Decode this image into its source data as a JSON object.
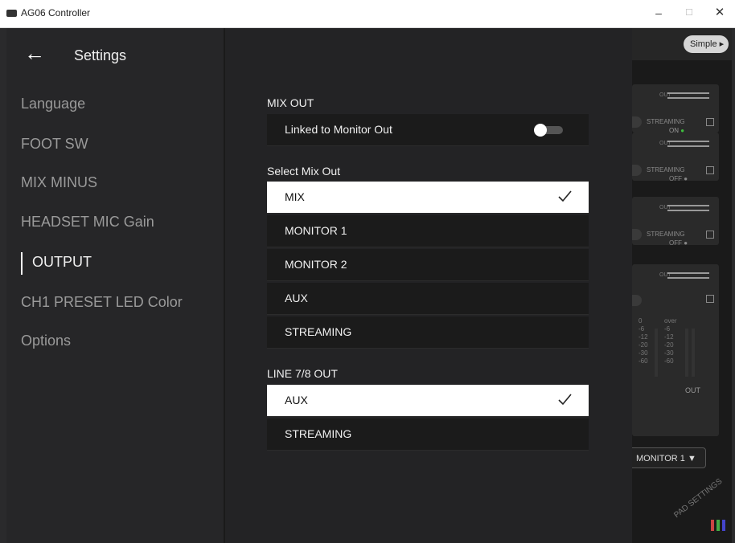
{
  "window": {
    "title": "AG06 Controller",
    "minimize": "–",
    "maximize": "☐",
    "close": "✕"
  },
  "background_app": {
    "simple_button": "Simple ▸",
    "out_label": "OUT",
    "streaming_label": "STREAMING",
    "streaming_states": [
      "ON ●",
      "OFF ●",
      "OFF ●"
    ],
    "monitor_select": "MONITOR 1  ▼",
    "pad_settings": "PAD SETTINGS",
    "scale": [
      "0",
      "-6",
      "-12",
      "-20",
      "-30",
      "-60"
    ],
    "over_label": "over",
    "out_meter_label": "OUT",
    "streaming_on_color": "#3fbf3f"
  },
  "sidebar": {
    "title": "Settings",
    "items": [
      {
        "label": "Language"
      },
      {
        "label": "FOOT SW"
      },
      {
        "label": "MIX MINUS"
      },
      {
        "label": "HEADSET MIC Gain"
      },
      {
        "label": "OUTPUT",
        "active": true
      },
      {
        "label": "CH1 PRESET LED Color"
      },
      {
        "label": "Options"
      }
    ]
  },
  "main": {
    "mix_out": {
      "section_label": "MIX OUT",
      "linked_label": "Linked to Monitor Out",
      "linked_toggle_on": true
    },
    "select_mix_out": {
      "section_label": "Select Mix Out",
      "options": [
        "MIX",
        "MONITOR 1",
        "MONITOR 2",
        "AUX",
        "STREAMING"
      ],
      "selected": "MIX"
    },
    "line_78_out": {
      "section_label": "LINE 7/8 OUT",
      "options": [
        "AUX",
        "STREAMING"
      ],
      "selected": "AUX"
    }
  }
}
